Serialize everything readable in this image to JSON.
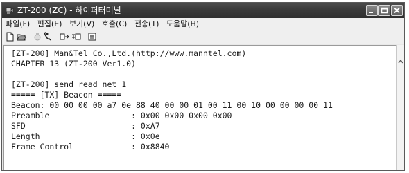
{
  "window": {
    "title": "ZT-200 (ZC) - 하이퍼터미널",
    "icons": [
      "hyperterminal-icon",
      "minimize-icon",
      "maximize-icon",
      "close-icon"
    ]
  },
  "menu": [
    {
      "label": "파일(F)"
    },
    {
      "label": "편집(E)"
    },
    {
      "label": "보기(V)"
    },
    {
      "label": "호출(C)"
    },
    {
      "label": "전송(T)"
    },
    {
      "label": "도움말(H)"
    }
  ],
  "toolbar": {
    "icons": [
      "new-icon",
      "open-icon",
      "disconnect-icon",
      "hangup-icon",
      "send-icon",
      "receive-icon",
      "properties-icon"
    ]
  },
  "terminal": {
    "lines": [
      "[ZT-200] Man&Tel Co.,Ltd.(http://www.manntel.com)",
      "CHAPTER 13 (ZT-200 Ver1.0)",
      "",
      "[ZT-200] send read net 1",
      "===== [TX] Beacon =====",
      "Beacon: 00 00 00 00 a7 0e 88 40 00 00 01 00 11 00 10 00 00 00 00 11",
      "Preamble                 : 0x00 0x00 0x00 0x00",
      "SFD                      : 0xA7",
      "Length                   : 0x0e",
      "Frame Control            : 0x8840"
    ]
  }
}
